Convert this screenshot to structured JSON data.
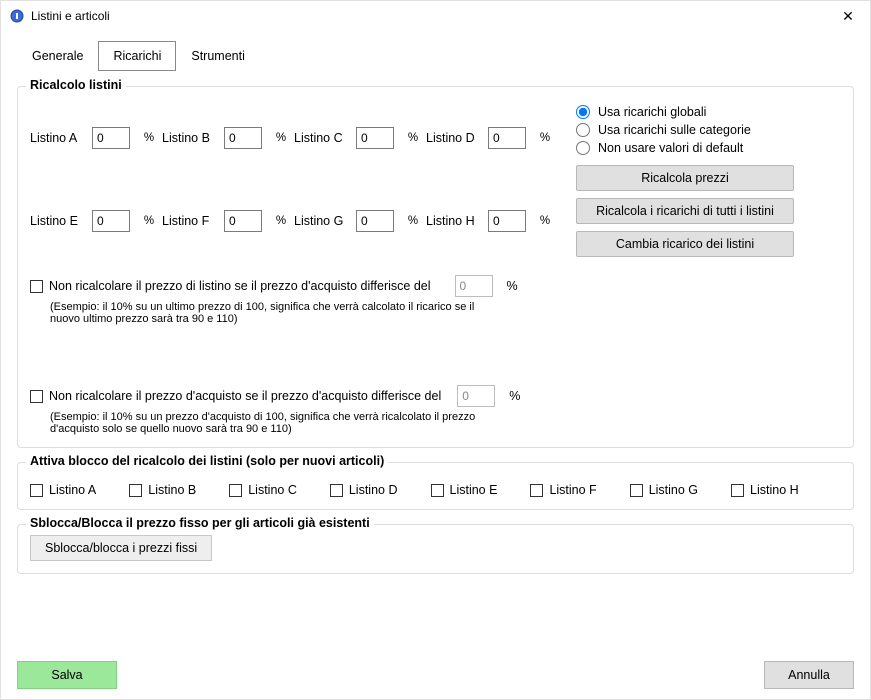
{
  "window": {
    "title": "Listini e articoli"
  },
  "tabs": {
    "generale": "Generale",
    "ricarichi": "Ricarichi",
    "strumenti": "Strumenti",
    "active": "ricarichi"
  },
  "group_ricalcolo": {
    "legend": "Ricalcolo listini",
    "labels": {
      "A": "Listino A",
      "B": "Listino B",
      "C": "Listino C",
      "D": "Listino D",
      "E": "Listino E",
      "F": "Listino F",
      "G": "Listino G",
      "H": "Listino H"
    },
    "values": {
      "A": "0",
      "B": "0",
      "C": "0",
      "D": "0",
      "E": "0",
      "F": "0",
      "G": "0",
      "H": "0"
    },
    "pct": "%",
    "radios": {
      "global": "Usa ricarichi globali",
      "categories": "Usa ricarichi sulle categorie",
      "none": "Non usare valori di default"
    },
    "buttons": {
      "recalc_prices": "Ricalcola prezzi",
      "recalc_all": "Ricalcola i ricarichi di tutti i listini",
      "change_markup": "Cambia ricarico dei listini"
    },
    "check1": {
      "label": "Non ricalcolare il prezzo di listino se il prezzo d'acquisto differisce del",
      "value": "0",
      "hint": "(Esempio: il 10% su un ultimo prezzo di 100, significa che verrà calcolato il ricarico se il nuovo ultimo prezzo sarà tra 90 e 110)"
    },
    "check2": {
      "label": "Non ricalcolare il prezzo d'acquisto se il prezzo d'acquisto differisce del",
      "value": "0",
      "hint": "(Esempio: il 10% su un prezzo d'acquisto di 100, significa che verrà ricalcolato il prezzo d'acquisto solo se quello nuovo sarà tra 90 e 110)"
    }
  },
  "group_block": {
    "legend": "Attiva blocco del ricalcolo dei listini (solo per nuovi articoli)",
    "items": {
      "A": "Listino A",
      "B": "Listino B",
      "C": "Listino C",
      "D": "Listino D",
      "E": "Listino E",
      "F": "Listino F",
      "G": "Listino G",
      "H": "Listino H"
    }
  },
  "group_unlock": {
    "legend": "Sblocca/Blocca il prezzo fisso per gli articoli già esistenti",
    "button": "Sblocca/blocca i prezzi fissi"
  },
  "bottom": {
    "save": "Salva",
    "cancel": "Annulla"
  }
}
